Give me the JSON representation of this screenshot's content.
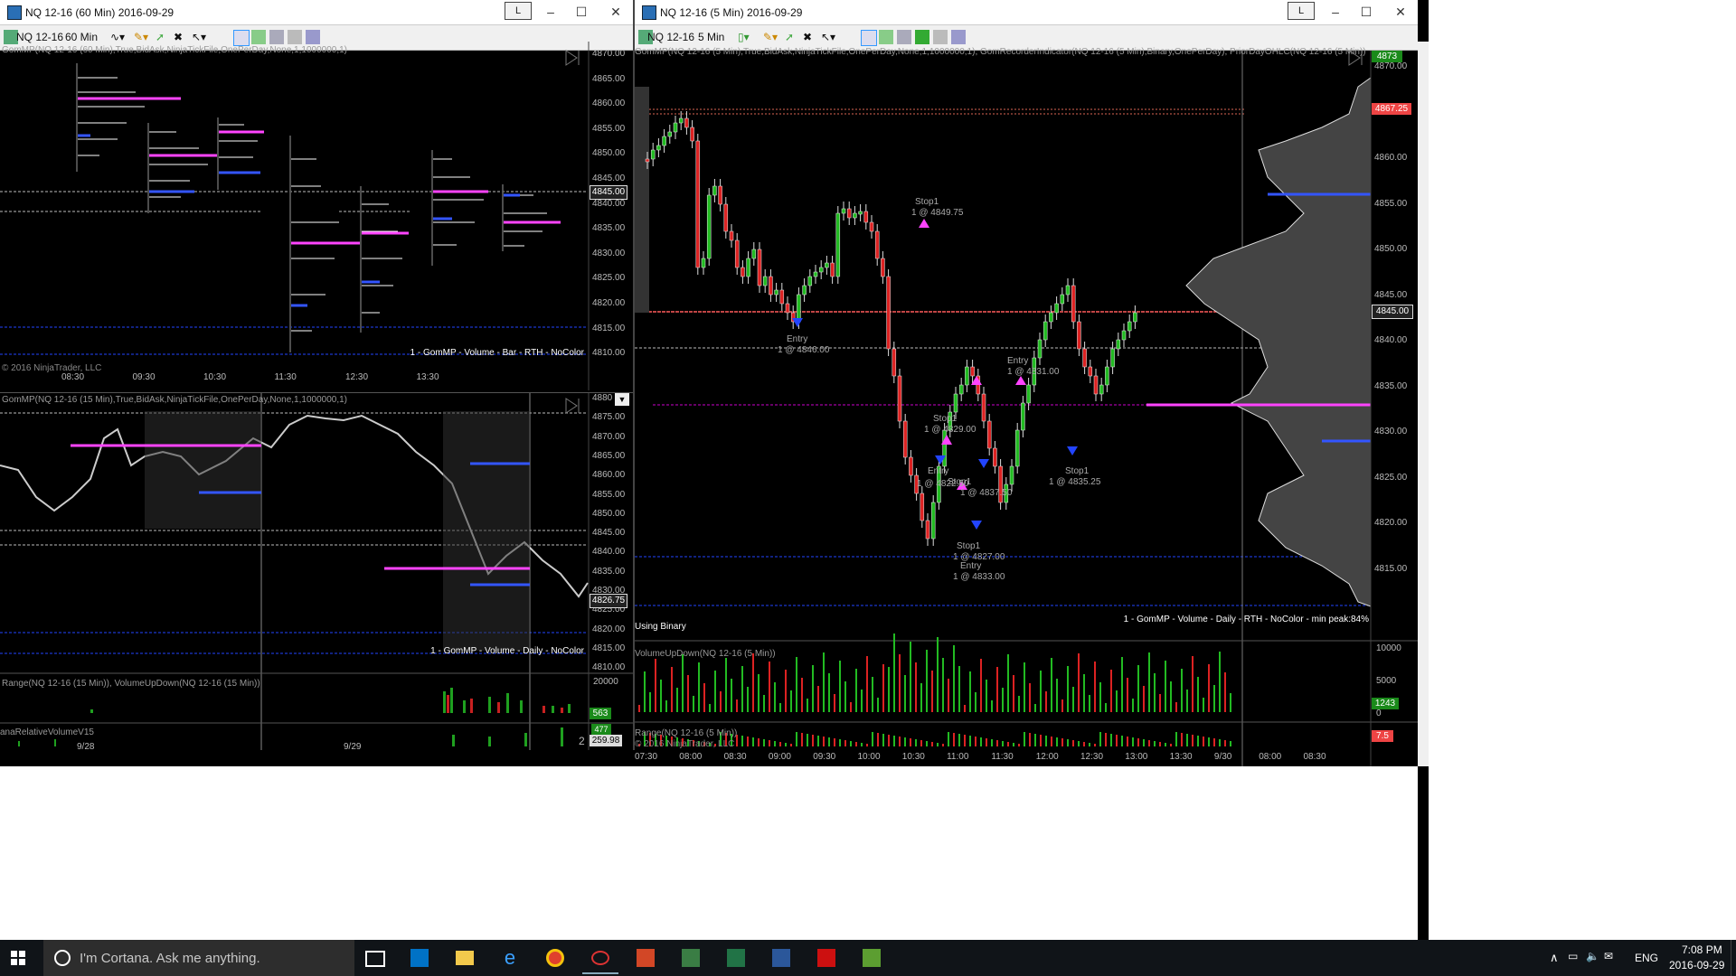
{
  "left_window": {
    "title": "NQ 12-16 (60 Min)  2016-09-29",
    "l_button": "L",
    "toolbar": {
      "instrument": "NQ 12-16",
      "interval": "60 Min"
    },
    "chart1": {
      "indicator_label": "GomMP(NQ 12-16 (60 Min),True,BidAsk,NinjaTickFile,OnePerDay,None,1,1000000,1)",
      "footer_label": "1 - GomMP - Volume - Bar - RTH - NoColor",
      "copyright": "© 2016 NinjaTrader, LLC",
      "price_ticks": [
        "4870.00",
        "4865.00",
        "4860.00",
        "4855.00",
        "4850.00",
        "4845.00",
        "4840.00",
        "4835.00",
        "4830.00",
        "4825.00",
        "4820.00",
        "4815.00",
        "4810.00"
      ],
      "current_price": "4845.00",
      "time_ticks": [
        "08:30",
        "09:30",
        "10:30",
        "11:30",
        "12:30",
        "13:30"
      ]
    },
    "chart2": {
      "indicator_label": "GomMP(NQ 12-16 (15 Min),True,BidAsk,NinjaTickFile,OnePerDay,None,1,1000000,1)",
      "footer_label": "1 - GomMP - Volume - Daily - NoColor",
      "price_ticks": [
        "4880",
        "4875.00",
        "4870.00",
        "4865.00",
        "4860.00",
        "4855.00",
        "4850.00",
        "4845.00",
        "4840.00",
        "4835.00",
        "4830.00",
        "4825.00",
        "4820.00",
        "4815.00",
        "4810.00"
      ],
      "current_price": "4826.75",
      "volume_label": "Range(NQ 12-16 (15 Min)), VolumeUpDown(NQ 12-16 (15 Min))",
      "volume_ticks": [
        "20000"
      ],
      "volume_badge": "563",
      "relvol_label": "anaRelativeVolumeV15",
      "relvol_badge_top": "477",
      "relvol_badge": "259.98",
      "relvol_right": "2",
      "time_ticks": [
        "9/28",
        "9/29"
      ]
    }
  },
  "right_window": {
    "title": "NQ 12-16 (5 Min)  2016-09-29",
    "l_button": "L",
    "toolbar": {
      "instrument": "NQ 12-16",
      "interval": "5 Min"
    },
    "chart": {
      "indicator_label": "GomMP(NQ 12-16 (5 Min),True,BidAsk,NinjaTickFile,OnePerDay,None,1,1000000,1), GomRecorderIndicator(NQ 12-16 (5 Min),Binary,OnePerDay), PriorDayOHLC(NQ 12-16 (5 Min))",
      "price_ticks": [
        "4870.00",
        "4865.00",
        "4860.00",
        "4855.00",
        "4850.00",
        "4845.00",
        "4840.00",
        "4835.00",
        "4830.00",
        "4825.00",
        "4820.00",
        "4815.00"
      ],
      "top_badge": "4873",
      "red_badge": "4867.25",
      "current_price": "4845.00",
      "using_binary": "Using Binary",
      "footer_label": "1 - GomMP - Volume - Daily - RTH - NoColor - min peak:84%",
      "volume_label": "VolumeUpDown(NQ 12-16 (5 Min))",
      "volume_ticks": [
        "10000",
        "5000",
        "0"
      ],
      "volume_badge": "1243",
      "range_label": "Range(NQ 12-16 (5 Min))",
      "range_copyright": "© 2016 NinjaTrader, LLC",
      "range_badge": "7.5",
      "time_ticks": [
        "07:30",
        "08:00",
        "08:30",
        "09:00",
        "09:30",
        "10:00",
        "10:30",
        "11:00",
        "11:30",
        "12:00",
        "12:30",
        "13:00",
        "13:30",
        "9/30",
        "08:00",
        "08:30"
      ],
      "trade_labels": [
        {
          "text": "Stop1"
        },
        {
          "text": "1 @ 4849.75"
        },
        {
          "text": "Entry"
        },
        {
          "text": "1 @ 4846.00"
        },
        {
          "text": "Stop1"
        },
        {
          "text": "1 @ 4829.00"
        },
        {
          "text": "Entry"
        },
        {
          "text": "1 @ 4831.00"
        },
        {
          "text": "Entry"
        },
        {
          "text": "1 @ 4822.50"
        },
        {
          "text": "Stop1"
        },
        {
          "text": "1 @ 4837.50"
        },
        {
          "text": "Stop1"
        },
        {
          "text": "1 @ 4835.25"
        },
        {
          "text": "Stop1"
        },
        {
          "text": "1 @ 4827.00"
        },
        {
          "text": "Entry"
        },
        {
          "text": "1 @ 4833.00"
        }
      ]
    }
  },
  "taskbar": {
    "search_placeholder": "I'm Cortana. Ask me anything.",
    "language": "ENG",
    "time": "7:08 PM",
    "date": "2016-09-29"
  },
  "colors": {
    "up_candle": "#22bb22",
    "down_candle": "#dd2222",
    "poc": "#ff44ff",
    "value_area": "#3355ff",
    "window_bg": "#000000"
  }
}
